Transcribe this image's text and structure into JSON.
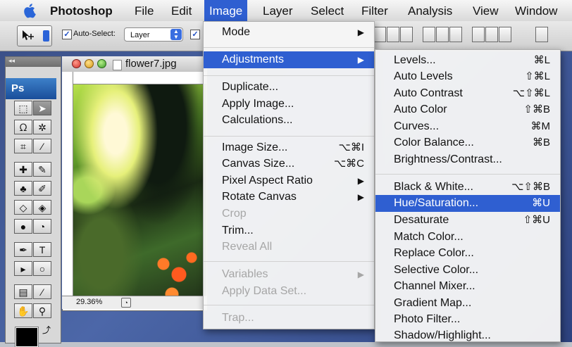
{
  "menubar": {
    "app": "Photoshop",
    "items": [
      "File",
      "Edit",
      "Image",
      "Layer",
      "Select",
      "Filter",
      "Analysis",
      "View",
      "Window"
    ],
    "active": "Image"
  },
  "options": {
    "auto_select_label": "Auto-Select:",
    "layer_select_value": "Layer"
  },
  "palette": {
    "logo": "Ps"
  },
  "document": {
    "title": "flower7.jpg",
    "zoom": "29.36%"
  },
  "image_menu": {
    "items": [
      {
        "label": "Mode",
        "submenu": true
      },
      {
        "label": "Adjustments",
        "submenu": true,
        "highlighted": true
      },
      {
        "label": "Duplicate..."
      },
      {
        "label": "Apply Image..."
      },
      {
        "label": "Calculations..."
      },
      {
        "label": "Image Size...",
        "shortcut": "⌥⌘I"
      },
      {
        "label": "Canvas Size...",
        "shortcut": "⌥⌘C"
      },
      {
        "label": "Pixel Aspect Ratio",
        "submenu": true
      },
      {
        "label": "Rotate Canvas",
        "submenu": true
      },
      {
        "label": "Crop",
        "disabled": true
      },
      {
        "label": "Trim..."
      },
      {
        "label": "Reveal All",
        "disabled": true
      },
      {
        "label": "Variables",
        "submenu": true,
        "disabled": true
      },
      {
        "label": "Apply Data Set...",
        "disabled": true
      },
      {
        "label": "Trap...",
        "disabled": true
      }
    ]
  },
  "adjustments_menu": {
    "items": [
      {
        "label": "Levels...",
        "shortcut": "⌘L"
      },
      {
        "label": "Auto Levels",
        "shortcut": "⇧⌘L"
      },
      {
        "label": "Auto Contrast",
        "shortcut": "⌥⇧⌘L"
      },
      {
        "label": "Auto Color",
        "shortcut": "⇧⌘B"
      },
      {
        "label": "Curves...",
        "shortcut": "⌘M"
      },
      {
        "label": "Color Balance...",
        "shortcut": "⌘B"
      },
      {
        "label": "Brightness/Contrast..."
      },
      {
        "label": "Black & White...",
        "shortcut": "⌥⇧⌘B"
      },
      {
        "label": "Hue/Saturation...",
        "shortcut": "⌘U",
        "highlighted": true
      },
      {
        "label": "Desaturate",
        "shortcut": "⇧⌘U"
      },
      {
        "label": "Match Color..."
      },
      {
        "label": "Replace Color..."
      },
      {
        "label": "Selective Color..."
      },
      {
        "label": "Channel Mixer..."
      },
      {
        "label": "Gradient Map..."
      },
      {
        "label": "Photo Filter..."
      },
      {
        "label": "Shadow/Highlight..."
      }
    ]
  },
  "colors": {
    "highlight": "#2f5fd1"
  }
}
